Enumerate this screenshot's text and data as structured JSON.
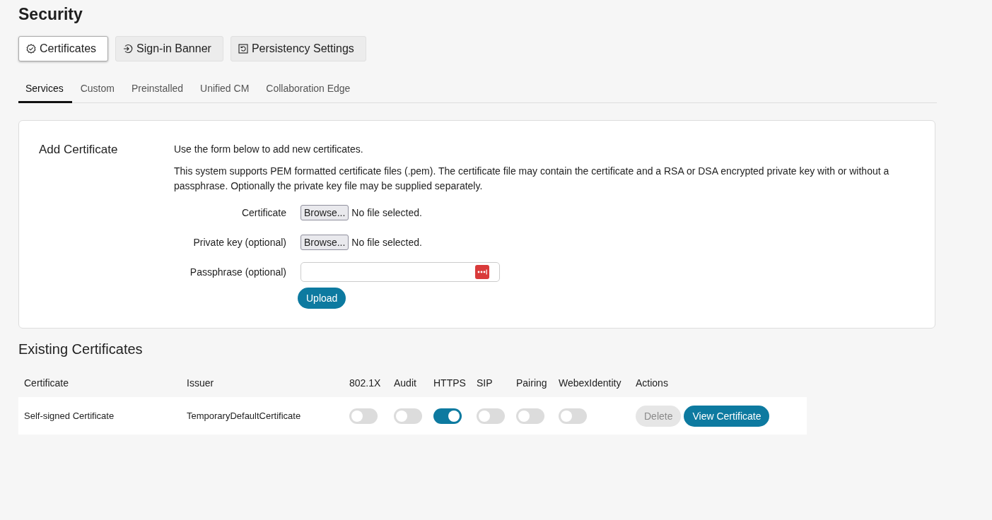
{
  "title": "Security",
  "sections": [
    {
      "label": "Certificates",
      "selected": true
    },
    {
      "label": "Sign-in Banner",
      "selected": false
    },
    {
      "label": "Persistency Settings",
      "selected": false
    }
  ],
  "tabs": [
    {
      "label": "Services",
      "selected": true
    },
    {
      "label": "Custom",
      "selected": false
    },
    {
      "label": "Preinstalled",
      "selected": false
    },
    {
      "label": "Unified CM",
      "selected": false
    },
    {
      "label": "Collaboration Edge",
      "selected": false
    }
  ],
  "add_certificate": {
    "heading": "Add Certificate",
    "intro": "Use the form below to add new certificates.",
    "description": "This system supports PEM formatted certificate files (.pem). The certificate file may contain the certificate and a RSA or DSA encrypted private key with or without a passphrase. Optionally the private key file may be supplied separately.",
    "fields": [
      {
        "kind": "file",
        "label": "Certificate",
        "button": "Browse...",
        "status": "No file selected."
      },
      {
        "kind": "file",
        "label": "Private key (optional)",
        "button": "Browse...",
        "status": "No file selected."
      },
      {
        "kind": "password",
        "label": "Passphrase (optional)"
      }
    ],
    "submit": "Upload"
  },
  "existing": {
    "heading": "Existing Certificates",
    "columns": [
      "Certificate",
      "Issuer",
      "802.1X",
      "Audit",
      "HTTPS",
      "SIP",
      "Pairing",
      "WebexIdentity",
      "Actions"
    ],
    "rows": [
      {
        "certificate": "Self-signed Certificate",
        "issuer": "TemporaryDefaultCertificate",
        "toggles": [
          {
            "on": false
          },
          {
            "on": false
          },
          {
            "on": true
          },
          {
            "on": false
          },
          {
            "on": false
          },
          {
            "on": false
          }
        ],
        "actions": [
          {
            "kind": "secondary",
            "label": "Delete",
            "disabled": true
          },
          {
            "kind": "primary",
            "label": "View Certificate",
            "disabled": false
          }
        ]
      }
    ]
  }
}
